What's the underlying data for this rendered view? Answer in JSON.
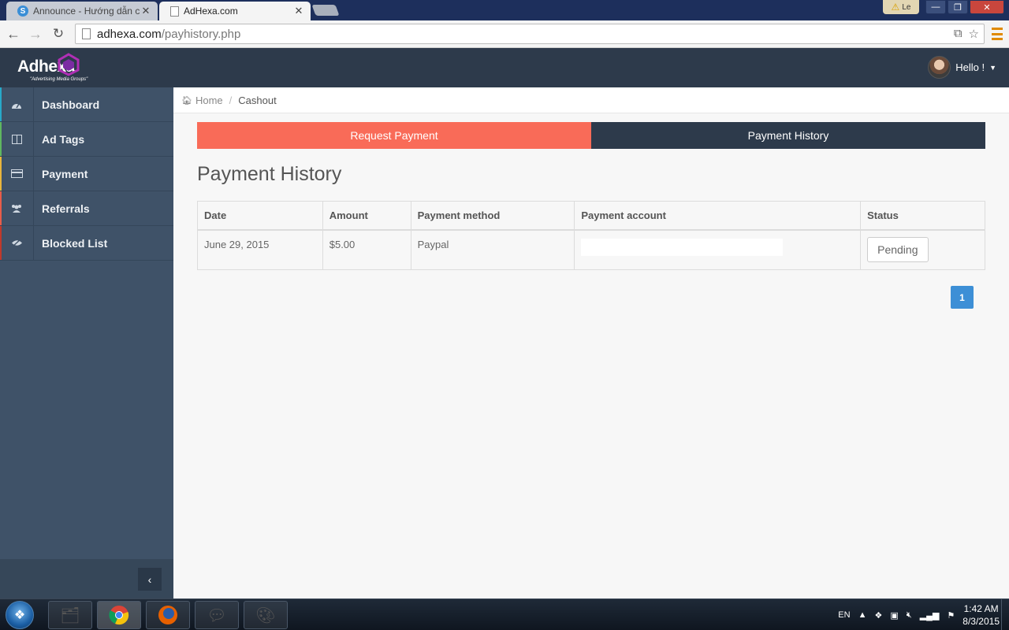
{
  "browser": {
    "tabs": [
      {
        "title": "Announce - Hướng dẫn c",
        "active": false,
        "favicon": "s-logo-icon"
      },
      {
        "title": "AdHexa.com",
        "active": true,
        "favicon": "page-icon"
      }
    ],
    "profile_label": "Le",
    "url_domain": "adhexa.com",
    "url_path": "/payhistory.php"
  },
  "header": {
    "logo": "Adhexa",
    "logo_tagline": "\"Advertising Media Groups\"",
    "greeting": "Hello !"
  },
  "sidebar": {
    "items": [
      {
        "label": "Dashboard",
        "icon": "dashboard-icon",
        "accent": "#27a9c9"
      },
      {
        "label": "Ad Tags",
        "icon": "columns-icon",
        "accent": "#5fb760"
      },
      {
        "label": "Payment",
        "icon": "credit-card-icon",
        "accent": "#e9b53c"
      },
      {
        "label": "Referrals",
        "icon": "users-icon",
        "accent": "#e85c4a"
      },
      {
        "label": "Blocked List",
        "icon": "eye-slash-icon",
        "accent": "#c0392b"
      }
    ]
  },
  "breadcrumb": {
    "home": "Home",
    "current": "Cashout"
  },
  "tabs": {
    "request": "Request Payment",
    "history": "Payment History"
  },
  "page": {
    "title": "Payment History"
  },
  "table": {
    "headers": [
      "Date",
      "Amount",
      "Payment method",
      "Payment account",
      "Status"
    ],
    "rows": [
      {
        "date": "June 29, 2015",
        "amount": "$5.00",
        "method": "Paypal",
        "account": "",
        "status": "Pending"
      }
    ]
  },
  "pagination": {
    "current_page": "1"
  },
  "taskbar": {
    "language": "EN",
    "time": "1:42 AM",
    "date": "8/3/2015"
  },
  "colors": {
    "header_bg": "#2d3a4b",
    "sidebar_bg": "#3f5268",
    "request_tab": "#f96b58",
    "history_tab": "#2d3a4b",
    "pagination": "#3d8fd6"
  }
}
